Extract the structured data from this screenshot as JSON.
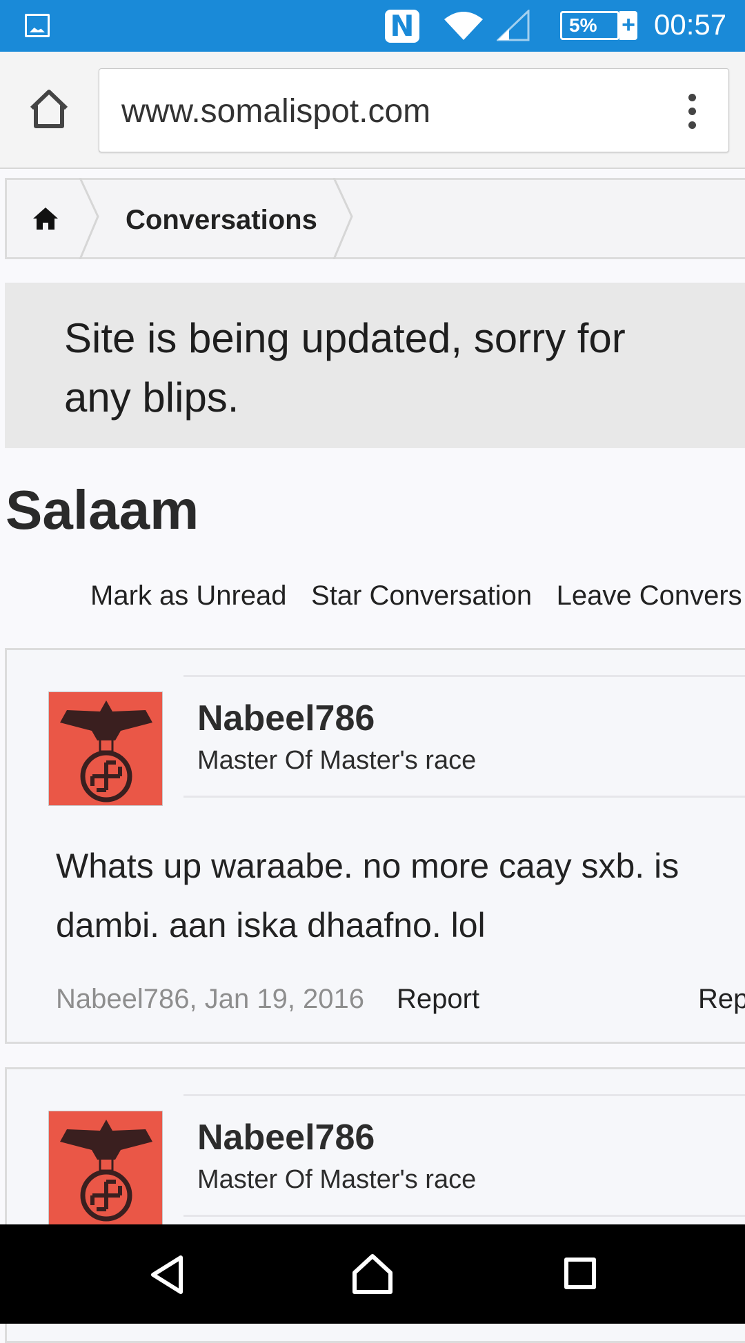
{
  "status_bar": {
    "time": "00:57",
    "battery_percent": "5%",
    "icons": [
      "gallery-icon",
      "nfc-icon",
      "wifi-icon",
      "signal-icon",
      "battery-icon",
      "charging-icon"
    ]
  },
  "browser": {
    "url": "www.somalispot.com",
    "icons": [
      "home-icon",
      "menu-kebab-icon"
    ]
  },
  "breadcrumb": {
    "home_icon": "home-icon",
    "items": [
      {
        "label": "Conversations"
      }
    ]
  },
  "notice": {
    "text": "Site is being updated, sorry for any blips."
  },
  "conversation": {
    "title": "Salaam",
    "actions": [
      {
        "label": "Mark as Unread"
      },
      {
        "label": "Star Conversation"
      },
      {
        "label": "Leave Convers"
      }
    ],
    "messages": [
      {
        "username": "Nabeel786",
        "user_title": "Master Of Master's race",
        "body": "Whats up waraabe. no more caay sxb. is dambi. aan iska dhaafno. lol",
        "meta_author_date": "Nabeel786, Jan 19, 2016",
        "report_label": "Report",
        "reply_label": "Repl"
      },
      {
        "username": "Nabeel786",
        "user_title": "Master Of Master's race"
      }
    ]
  },
  "nav_bar": {
    "icons": [
      "back-icon",
      "home-icon",
      "recents-icon"
    ]
  },
  "colors": {
    "status_bar": "#1a8ad8",
    "avatar_bg": "#ea5747",
    "notice_bg": "#e8e8e8"
  }
}
